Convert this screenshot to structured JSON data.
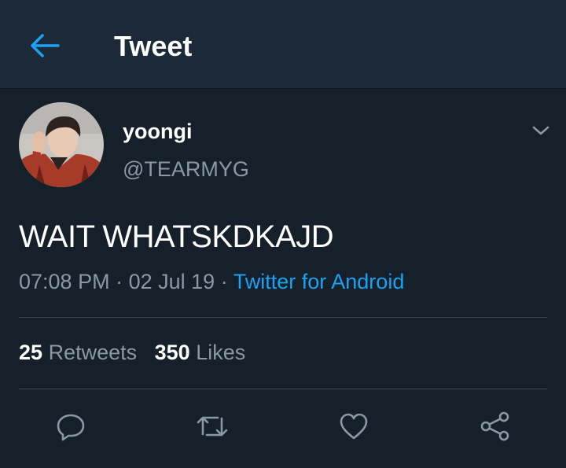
{
  "header": {
    "back_icon": "arrow-left-icon",
    "title": "Tweet"
  },
  "tweet": {
    "display_name": "yoongi",
    "handle": "@TEARMYG",
    "text": "WAIT WHATSKDKAJD",
    "time": "07:08 PM",
    "separator": "·",
    "date": "02 Jul 19",
    "source": "Twitter for Android",
    "retweets_count": "25",
    "retweets_label": "Retweets",
    "likes_count": "350",
    "likes_label": "Likes"
  },
  "actions": [
    "reply-icon",
    "retweet-icon",
    "like-icon",
    "share-icon"
  ],
  "colors": {
    "background": "#15202b",
    "header": "#1c2938",
    "accent": "#1da1f2",
    "secondary_text": "#8899a6",
    "divider": "#38444d"
  }
}
